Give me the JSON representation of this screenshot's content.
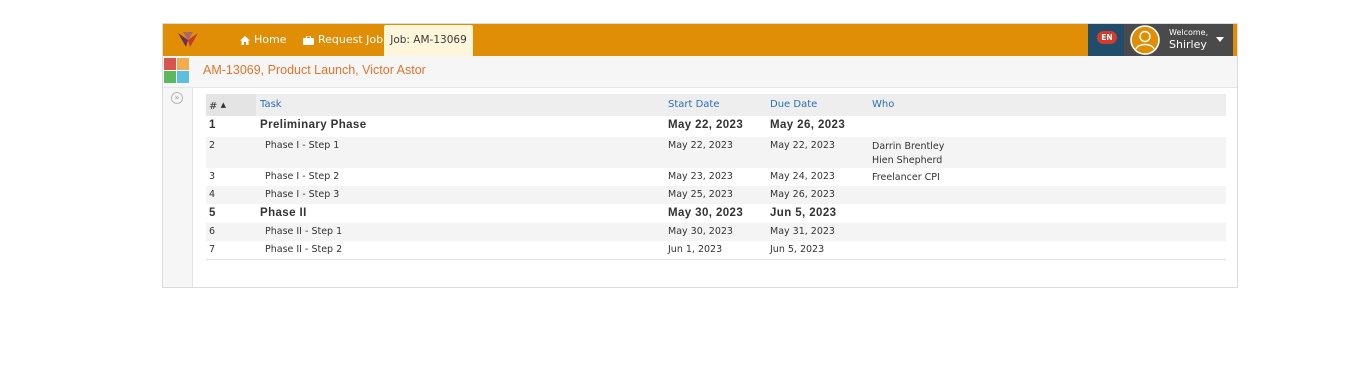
{
  "navbar": {
    "home_label": "Home",
    "request_label": "Request Job",
    "job_tab_label": "Job: AM-13069",
    "lang_label": "EN",
    "welcome_label": "Welcome,",
    "user_name": "Shirley",
    "colors": {
      "bar": "#e08e06",
      "lang_bg": "#1f4d6b",
      "user_bg": "#4a4a4a",
      "badge": "#d63a2c"
    }
  },
  "subheader": {
    "title": "AM-13069, Product Launch, Victor Astor",
    "title_color": "#e0752b",
    "app_tile_colors": [
      "#d9534f",
      "#f0ad4e",
      "#5cb85c",
      "#5bc0de"
    ]
  },
  "table": {
    "headers": {
      "num": "#",
      "task": "Task",
      "start": "Start Date",
      "due": "Due Date",
      "who": "Who"
    },
    "rows": [
      {
        "num": "1",
        "task": "Preliminary Phase",
        "start": "May 22, 2023",
        "due": "May 26, 2023",
        "who": [],
        "kind": "phase"
      },
      {
        "num": "2",
        "task": "Phase I - Step 1",
        "start": "May 22, 2023",
        "due": "May 22, 2023",
        "who": [
          "Darrin Brentley",
          "Hien Shepherd"
        ],
        "kind": "step"
      },
      {
        "num": "3",
        "task": "Phase I - Step 2",
        "start": "May 23, 2023",
        "due": "May 24, 2023",
        "who": [
          "Freelancer CPI"
        ],
        "kind": "step"
      },
      {
        "num": "4",
        "task": "Phase I - Step 3",
        "start": "May 25, 2023",
        "due": "May 26, 2023",
        "who": [],
        "kind": "step"
      },
      {
        "num": "5",
        "task": "Phase II",
        "start": "May 30, 2023",
        "due": "Jun 5, 2023",
        "who": [],
        "kind": "phase"
      },
      {
        "num": "6",
        "task": "Phase II - Step 1",
        "start": "May 30, 2023",
        "due": "May 31, 2023",
        "who": [],
        "kind": "step"
      },
      {
        "num": "7",
        "task": "Phase II - Step 2",
        "start": "Jun 1, 2023",
        "due": "Jun 5, 2023",
        "who": [],
        "kind": "step"
      }
    ]
  }
}
